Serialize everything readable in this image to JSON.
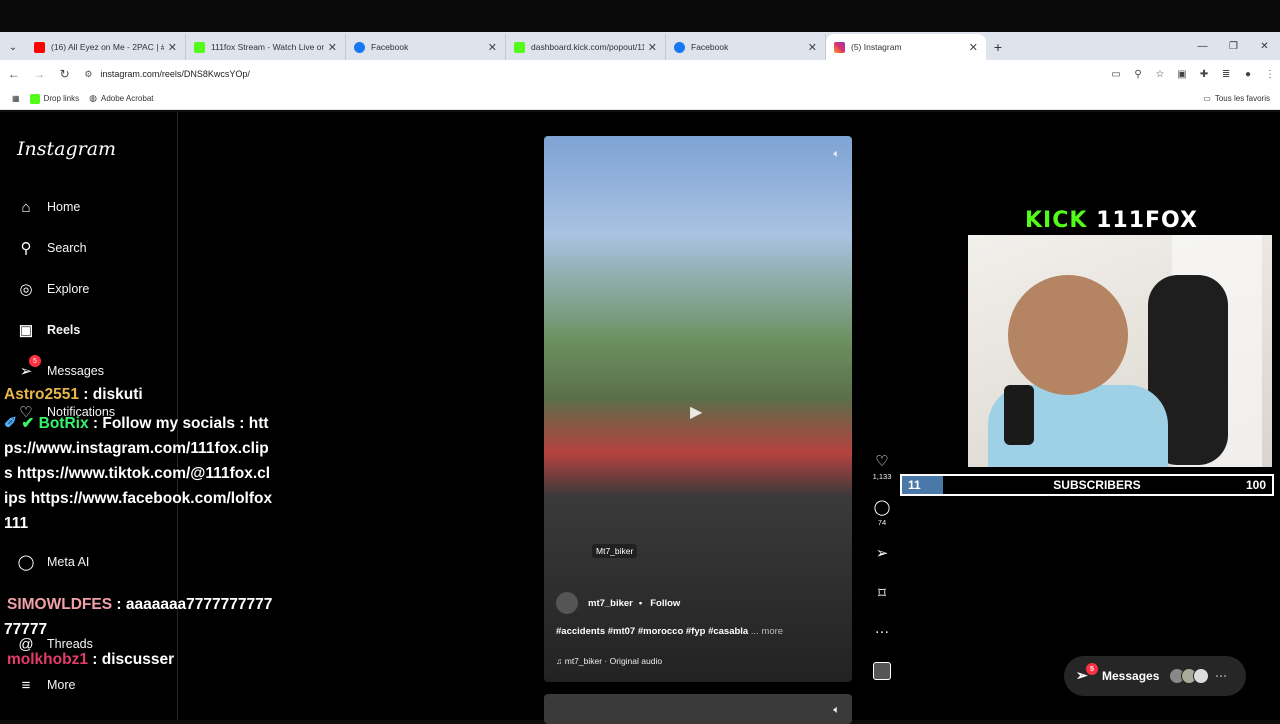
{
  "browser": {
    "tabs": [
      {
        "title": "(16) All Eyez on Me - 2PAC | #",
        "favicon": "#ff0000",
        "active": false
      },
      {
        "title": "111fox Stream - Watch Live on",
        "favicon": "#53fc18",
        "active": false
      },
      {
        "title": "Facebook",
        "favicon": "#1877f2",
        "active": false
      },
      {
        "title": "dashboard.kick.com/popout/11",
        "favicon": "#53fc18",
        "active": false
      },
      {
        "title": "Facebook",
        "favicon": "#1877f2",
        "active": false
      },
      {
        "title": "(5) Instagram",
        "favicon": "#e1306c",
        "active": true
      }
    ],
    "url": "instagram.com/reels/DNS8KwcsYOp/",
    "bookmarks": [
      {
        "label": "Drop links",
        "color": "#53fc18"
      },
      {
        "label": "Adobe Acrobat",
        "color": "#888888"
      }
    ],
    "all_bookmarks": "Tous les favoris"
  },
  "instagram": {
    "logo": "Instagram",
    "nav": [
      {
        "label": "Home",
        "icon": "home-icon",
        "glyph": "⌂"
      },
      {
        "label": "Search",
        "icon": "search-icon",
        "glyph": "⚲"
      },
      {
        "label": "Explore",
        "icon": "compass-icon",
        "glyph": "◎"
      },
      {
        "label": "Reels",
        "icon": "reels-icon",
        "glyph": "▣"
      },
      {
        "label": "Messages",
        "icon": "messages-icon",
        "glyph": "➢",
        "badge": "5"
      },
      {
        "label": "Notifications",
        "icon": "heart-icon",
        "glyph": "♡"
      },
      {
        "label": "Meta AI",
        "icon": "meta-ai-icon",
        "glyph": "◯"
      },
      {
        "label": "Threads",
        "icon": "threads-icon",
        "glyph": "@"
      },
      {
        "label": "More",
        "icon": "menu-icon",
        "glyph": "≡"
      }
    ],
    "reel": {
      "overlay_tag": "Mt7_biker",
      "author": "mt7_biker",
      "follow": "Follow",
      "caption": "#accidents #mt07 #morocco #fyp #casabla",
      "more": "... more",
      "audio": "♫ mt7_biker · Original audio"
    },
    "actions": {
      "likes": "1,133",
      "comments": "74"
    },
    "messages_pill": {
      "label": "Messages",
      "badge": "5"
    }
  },
  "overlay": {
    "cam_title_kick": "KICK",
    "cam_title_name": "111FOX",
    "subs": {
      "current": "11",
      "label": "SUBSCRIBERS",
      "goal": "100",
      "progress": 0.11
    },
    "chat": [
      {
        "user": "Astro2551",
        "msg": " : diskuti"
      },
      {
        "user": "BotRix",
        "msg": " : Follow my socials : https://www.instagram.com/111fox.clips https://www.tiktok.com/@111fox.clips https://www.facebook.com/lolfox111"
      },
      {
        "user": "SIMOWLDFES",
        "msg": " : aaaaaaa777777777777777"
      },
      {
        "user": "molkhobz1",
        "msg": " : discusser"
      }
    ]
  }
}
